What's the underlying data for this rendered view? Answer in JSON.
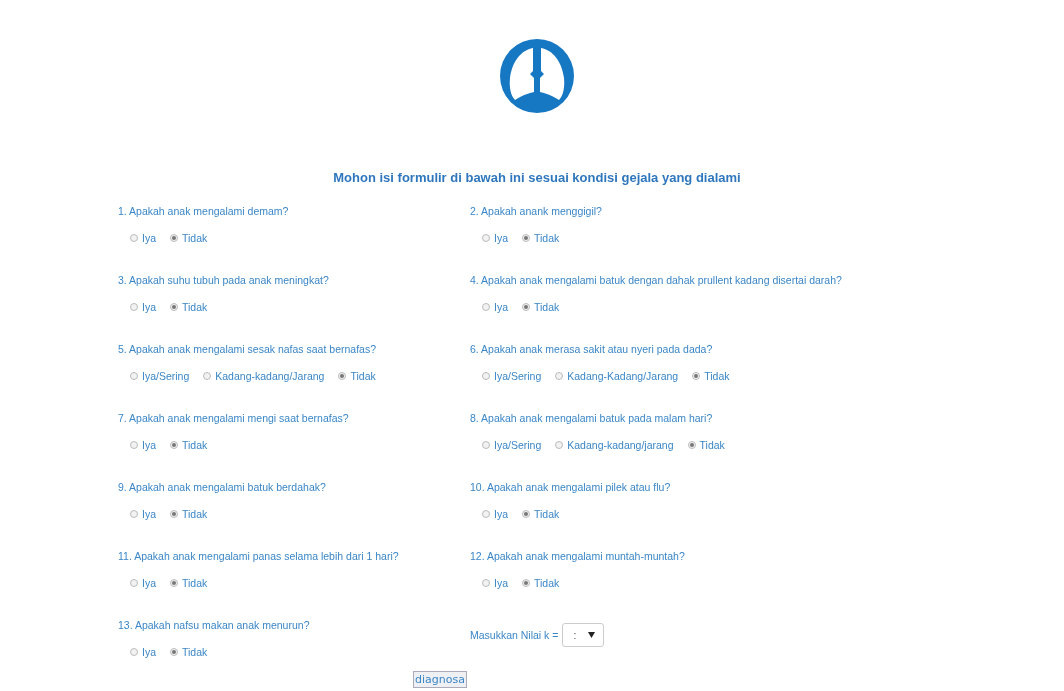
{
  "title": "Mohon isi formulir di bawah ini sesuai kondisi gejala yang dialami",
  "rows": [
    {
      "cells": [
        {
          "kind": "radio",
          "question": "1. Apakah anak mengalami demam?",
          "options": [
            {
              "label": "Iya",
              "selected": false
            },
            {
              "label": "Tidak",
              "selected": true
            }
          ]
        },
        {
          "kind": "radio",
          "question": "2. Apakah anank menggigil?",
          "options": [
            {
              "label": "Iya",
              "selected": false
            },
            {
              "label": "Tidak",
              "selected": true
            }
          ]
        }
      ]
    },
    {
      "cells": [
        {
          "kind": "radio",
          "question": "3. Apakah suhu tubuh pada anak meningkat?",
          "options": [
            {
              "label": "Iya",
              "selected": false
            },
            {
              "label": "Tidak",
              "selected": true
            }
          ]
        },
        {
          "kind": "radio",
          "question": "4. Apakah anak mengalami batuk dengan dahak prullent kadang disertai darah?",
          "options": [
            {
              "label": "Iya",
              "selected": false
            },
            {
              "label": "Tidak",
              "selected": true
            }
          ]
        }
      ]
    },
    {
      "cells": [
        {
          "kind": "radio",
          "question": "5. Apakah anak mengalami sesak nafas saat bernafas?",
          "options": [
            {
              "label": "Iya/Sering",
              "selected": false
            },
            {
              "label": "Kadang-kadang/Jarang",
              "selected": false
            },
            {
              "label": "Tidak",
              "selected": true
            }
          ]
        },
        {
          "kind": "radio",
          "question": "6. Apakah anak merasa sakit atau nyeri pada dada?",
          "options": [
            {
              "label": "Iya/Sering",
              "selected": false
            },
            {
              "label": "Kadang-Kadang/Jarang",
              "selected": false
            },
            {
              "label": "Tidak",
              "selected": true
            }
          ]
        }
      ]
    },
    {
      "cells": [
        {
          "kind": "radio",
          "question": "7. Apakah anak mengalami mengi saat bernafas?",
          "options": [
            {
              "label": "Iya",
              "selected": false
            },
            {
              "label": "Tidak",
              "selected": true
            }
          ]
        },
        {
          "kind": "radio",
          "question": "8. Apakah anak mengalami batuk pada malam hari?",
          "options": [
            {
              "label": "Iya/Sering",
              "selected": false
            },
            {
              "label": "Kadang-kadang/jarang",
              "selected": false
            },
            {
              "label": "Tidak",
              "selected": true
            }
          ]
        }
      ]
    },
    {
      "cells": [
        {
          "kind": "radio",
          "question": "9. Apakah anak mengalami batuk berdahak?",
          "options": [
            {
              "label": "Iya",
              "selected": false
            },
            {
              "label": "Tidak",
              "selected": true
            }
          ]
        },
        {
          "kind": "radio",
          "question": "10. Apakah anak mengalami pilek atau flu?",
          "options": [
            {
              "label": "Iya",
              "selected": false
            },
            {
              "label": "Tidak",
              "selected": true
            }
          ]
        }
      ]
    },
    {
      "cells": [
        {
          "kind": "radio",
          "question": "11. Apakah anak mengalami panas selama lebih dari 1 hari?",
          "options": [
            {
              "label": "Iya",
              "selected": false
            },
            {
              "label": "Tidak",
              "selected": true
            }
          ]
        },
        {
          "kind": "radio",
          "question": "12. Apakah anak mengalami muntah-muntah?",
          "options": [
            {
              "label": "Iya",
              "selected": false
            },
            {
              "label": "Tidak",
              "selected": true
            }
          ]
        }
      ]
    },
    {
      "cells": [
        {
          "kind": "radio",
          "question": "13. Apakah nafsu makan anak menurun?",
          "options": [
            {
              "label": "Iya",
              "selected": false
            },
            {
              "label": "Tidak",
              "selected": true
            }
          ]
        },
        {
          "kind": "select",
          "label": "Masukkan Nilai k =",
          "value": ":"
        }
      ]
    }
  ],
  "submit": "diagnosa"
}
